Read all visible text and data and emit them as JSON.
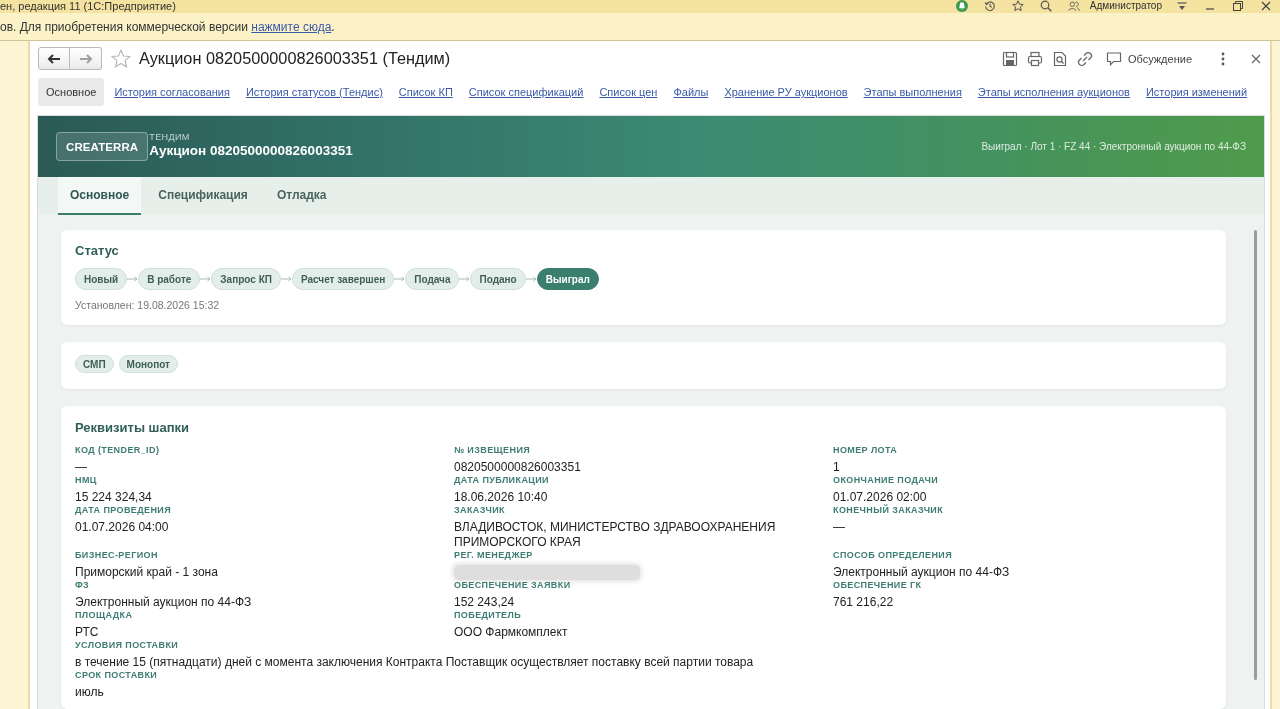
{
  "title_bar": {
    "title": "ен, редакция 11 (1С:Предприятие)",
    "user": "Администратор"
  },
  "notice": {
    "text": "ов. Для приобретения коммерческой версии ",
    "link": "нажмите сюда",
    "end": "."
  },
  "form": {
    "title": "Аукцион 0820500000826003351 (Тендим)",
    "favorite": false,
    "back_disabled": false,
    "forward_disabled": true,
    "discussion": "Обсуждение",
    "sections": [
      {
        "label": "Основное",
        "selected": true
      },
      {
        "label": "История согласования",
        "selected": false
      },
      {
        "label": "История статусов (Тендис)",
        "selected": false
      },
      {
        "label": "Список КП",
        "selected": false
      },
      {
        "label": "Список спецификаций",
        "selected": false
      },
      {
        "label": "Список цен",
        "selected": false
      },
      {
        "label": "Файлы",
        "selected": false
      },
      {
        "label": "Хранение РУ аукционов",
        "selected": false
      },
      {
        "label": "Этапы выполнения",
        "selected": false
      },
      {
        "label": "Этапы исполнения аукционов",
        "selected": false
      },
      {
        "label": "История изменений",
        "selected": false
      }
    ]
  },
  "panel": {
    "logo": "CREATERRA",
    "kicker": "ТЕНДИМ",
    "title": "Аукцион 0820500000826003351",
    "summary": "Выиграл · Лот 1 · FZ 44 · Электронный аукцион по 44-ФЗ",
    "tabs": [
      {
        "label": "Основное",
        "selected": true
      },
      {
        "label": "Спецификация",
        "selected": false
      },
      {
        "label": "Отладка",
        "selected": false
      }
    ]
  },
  "status": {
    "title": "Статус",
    "steps": [
      {
        "label": "Новый",
        "selected": false
      },
      {
        "label": "В работе",
        "selected": false
      },
      {
        "label": "Запрос КП",
        "selected": false
      },
      {
        "label": "Расчет завершен",
        "selected": false
      },
      {
        "label": "Подача",
        "selected": false
      },
      {
        "label": "Подано",
        "selected": false
      },
      {
        "label": "Выиграл",
        "selected": true
      }
    ],
    "set_at": "Установлен: 19.08.2026 15:32"
  },
  "tags": [
    "СМП",
    "Монопот"
  ],
  "details": {
    "title": "Реквизиты шапки",
    "fields": [
      {
        "kind": "text",
        "label": "КОД (TENDER_ID)",
        "value": "—"
      },
      {
        "kind": "text",
        "label": "№ ИЗВЕЩЕНИЯ",
        "value": "0820500000826003351"
      },
      {
        "kind": "text",
        "label": "НОМЕР ЛОТА",
        "value": "1"
      },
      {
        "kind": "text",
        "label": "НМЦ",
        "value": "15 224 324,34"
      },
      {
        "kind": "text",
        "label": "ДАТА ПУБЛИКАЦИИ",
        "value": "18.06.2026 10:40"
      },
      {
        "kind": "text",
        "label": "ОКОНЧАНИЕ ПОДАЧИ",
        "value": "01.07.2026 02:00"
      },
      {
        "kind": "text",
        "label": "ДАТА ПРОВЕДЕНИЯ",
        "value": "01.07.2026 04:00"
      },
      {
        "kind": "text",
        "label": "ЗАКАЗЧИК",
        "value": "ВЛАДИВОСТОК, МИНИСТЕРСТВО ЗДРАВООХРАНЕНИЯ ПРИМОРСКОГО КРАЯ"
      },
      {
        "kind": "text",
        "label": "КОНЕЧНЫЙ ЗАКАЗЧИК",
        "value": "—"
      },
      {
        "kind": "text",
        "label": "БИЗНЕС-РЕГИОН",
        "value": "Приморский край - 1 зона"
      },
      {
        "kind": "blurred",
        "label": "РЕГ. МЕНЕДЖЕР"
      },
      {
        "kind": "text",
        "label": "СПОСОБ ОПРЕДЕЛЕНИЯ",
        "value": "Электронный аукцион по 44-ФЗ"
      },
      {
        "kind": "text",
        "label": "ФЗ",
        "value": "Электронный аукцион по 44-ФЗ"
      },
      {
        "kind": "text",
        "label": "ОБЕСПЕЧЕНИЕ ЗАЯВКИ",
        "value": "152 243,24"
      },
      {
        "kind": "text",
        "label": "ОБЕСПЕЧЕНИЕ ГК",
        "value": "761 216,22"
      },
      {
        "kind": "text",
        "label": "ПЛОЩАДКА",
        "value": "РТС"
      },
      {
        "kind": "text",
        "label": "ПОБЕДИТЕЛЬ",
        "value": "ООО Фармкомплект"
      }
    ],
    "wide_fields": [
      {
        "label": "УСЛОВИЯ ПОСТАВКИ",
        "value": "в течение 15 (пятнадцати) дней с момента заключения Контракта Поставщик осуществляет поставку всей партии товара"
      },
      {
        "label": "СРОК ПОСТАВКИ",
        "value": "июль"
      }
    ]
  }
}
